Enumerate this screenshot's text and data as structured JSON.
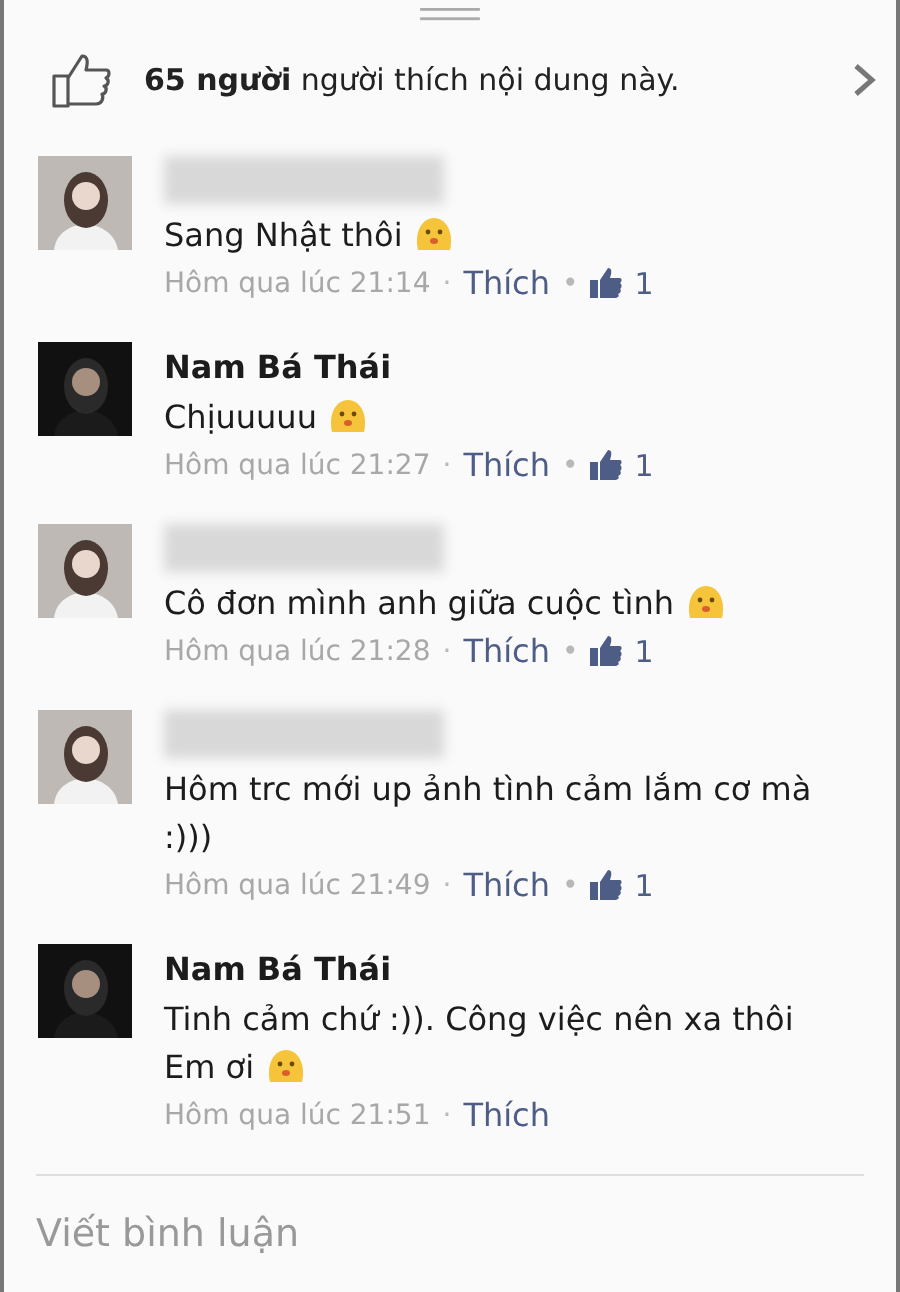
{
  "likes_summary": {
    "text": "**65 người** người thích nội dung này."
  },
  "comments": [
    {
      "name_hidden": true,
      "text": "Sang Nhật thôi",
      "has_emoji": true,
      "time": "Hôm qua lúc 21:14",
      "separator": "·",
      "like_label": "Thích",
      "likes_separator": "•",
      "likes": "1"
    },
    {
      "name_hidden": false,
      "name": "Nam Bá Thái",
      "text": "Chịuuuuu",
      "has_emoji": true,
      "time": "Hôm qua lúc 21:27",
      "separator": "·",
      "like_label": "Thích",
      "likes_separator": "•",
      "likes": "1"
    },
    {
      "name_hidden": true,
      "text": "Cô đơn mình anh giữa cuộc tình",
      "has_emoji": true,
      "time": "Hôm qua lúc 21:28",
      "separator": "·",
      "like_label": "Thích",
      "likes_separator": "•",
      "likes": "1"
    },
    {
      "name_hidden": true,
      "text": "Hôm trc mới up ảnh tình cảm lắm cơ mà :)))",
      "has_emoji": false,
      "time": "Hôm qua lúc 21:49",
      "separator": "·",
      "like_label": "Thích",
      "likes_separator": "•",
      "likes": "1"
    },
    {
      "name_hidden": false,
      "name": "Nam Bá Thái",
      "text": "Tinh cảm chứ :)). Công việc nên xa thôi Em ơi",
      "has_emoji": true,
      "time": "Hôm qua lúc 21:51",
      "separator": "·",
      "like_label": "Thích"
    }
  ],
  "composer": {
    "placeholder": "Viết bình luận"
  }
}
